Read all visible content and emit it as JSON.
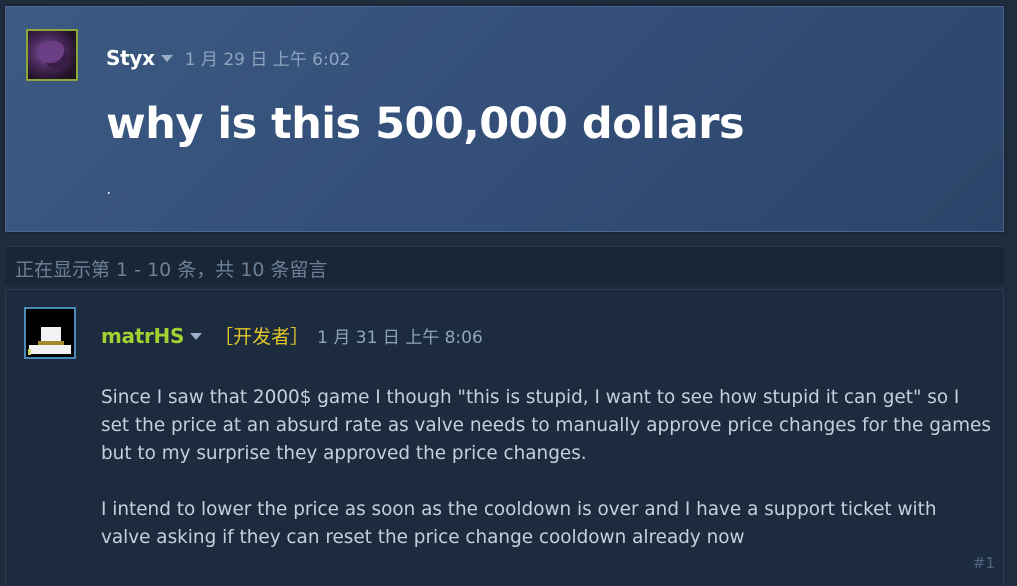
{
  "topic": {
    "author": "Styx",
    "timestamp": "1 月 29 日 上午 6:02",
    "title": "why is this 500,000 dollars",
    "body": "."
  },
  "paging": {
    "text": "正在显示第 1 - 10 条，共 10 条留言"
  },
  "comments": [
    {
      "author": "matrHS",
      "badge": "［开发者］",
      "timestamp": "1 月 31 日 上午 8:06",
      "paragraphs": [
        "Since I saw that 2000$ game I though \"this is stupid, I want to see how stupid it can get\" so I set the price at an absurd rate as valve needs to manually approve price changes for the games but to my surprise they approved the price changes.",
        "I intend to lower the price as soon as the cooldown is over and I have a support ticket with valve asking if they can reset the price change cooldown already now"
      ],
      "index": "#1"
    }
  ],
  "icons": {
    "author_menu": "chevron-down-icon"
  },
  "colors": {
    "developer_name": "#a3d132",
    "developer_badge": "#e0c52a",
    "op_background": "#34507a",
    "page_background": "#1e2c3e"
  }
}
